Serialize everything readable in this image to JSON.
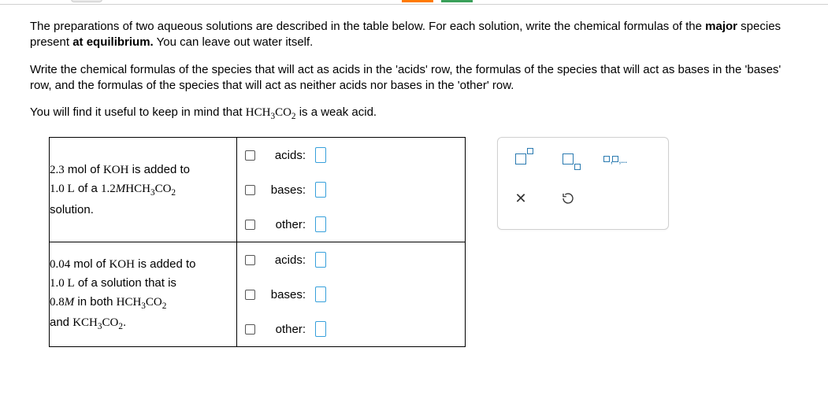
{
  "instructions": {
    "p1_a": "The preparations of two aqueous solutions are described in the table below. For each solution, write the chemical formulas of the ",
    "p1_b": "major",
    "p1_c": " species present ",
    "p1_d": "at equilibrium.",
    "p1_e": " You can leave out water itself.",
    "p2": "Write the chemical formulas of the species that will act as acids in the 'acids' row, the formulas of the species that will act as bases in the 'bases' row, and the formulas of the species that will act as neither acids nor bases in the 'other' row.",
    "p3_a": "You will find it useful to keep in mind that ",
    "p3_b": " is a weak acid."
  },
  "formula": {
    "hch3co2_pre": "HCH",
    "hch3co2_sub1": "3",
    "hch3co2_mid": "CO",
    "hch3co2_sub2": "2",
    "kch3co2_pre": "KCH",
    "koh": "KOH"
  },
  "table": {
    "row1": {
      "l1a": "2.3",
      "l1b": " mol of ",
      "l1c": " is added to",
      "l2a": "1.0 L",
      "l2b": " of a ",
      "l2c": "1.2",
      "l2d": "M",
      "l3": "solution."
    },
    "row2": {
      "l1a": "0.04",
      "l1b": " mol of ",
      "l1c": " is added to",
      "l2a": "1.0 L",
      "l2b": " of a solution that is",
      "l3a": "0.8",
      "l3b": "M",
      "l3c": " in both ",
      "l4a": "and ",
      "l4b": "."
    },
    "labels": {
      "acids": "acids:",
      "bases": "bases:",
      "other": "other:"
    }
  },
  "tools": {
    "list_sep": ",",
    "list_ell": ",..."
  }
}
